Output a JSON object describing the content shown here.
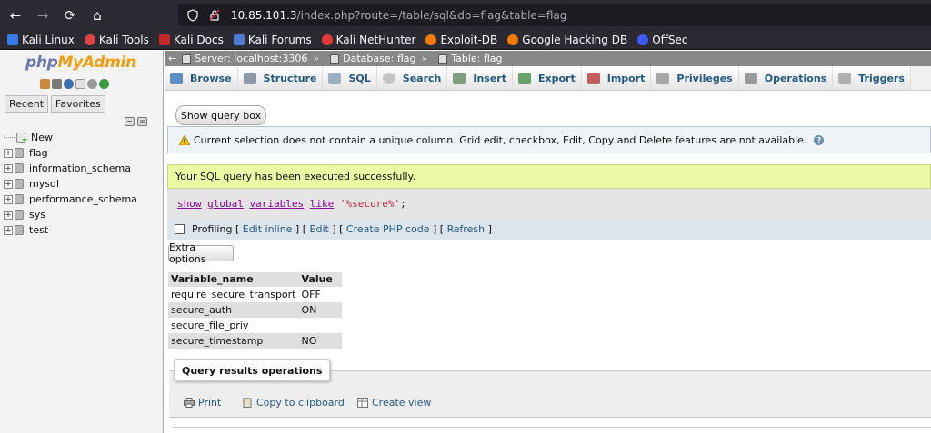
{
  "browser": {
    "url_host": "10.85.101.3",
    "url_path": "/index.php?route=/table/sql&db=flag&table=flag",
    "bookmarks": [
      "Kali Linux",
      "Kali Tools",
      "Kali Docs",
      "Kali Forums",
      "Kali NetHunter",
      "Exploit-DB",
      "Google Hacking DB",
      "OffSec"
    ]
  },
  "sidebar": {
    "logo_php": "php",
    "logo_my": "MyAdmin",
    "tab_recent": "Recent",
    "tab_favorites": "Favorites",
    "databases": [
      "New",
      "flag",
      "information_schema",
      "mysql",
      "performance_schema",
      "sys",
      "test"
    ]
  },
  "breadcrumb": {
    "server": "Server: localhost:3306",
    "database": "Database: flag",
    "table": "Table: flag"
  },
  "menu": {
    "items": [
      "Browse",
      "Structure",
      "SQL",
      "Search",
      "Insert",
      "Export",
      "Import",
      "Privileges",
      "Operations",
      "Triggers"
    ]
  },
  "main": {
    "show_query_box": "Show query box",
    "warning": "Current selection does not contain a unique column. Grid edit, checkbox, Edit, Copy and Delete features are not available.",
    "success": "Your SQL query has been executed successfully.",
    "sql": {
      "kw1": "show",
      "kw2": "global",
      "kw3": "variables",
      "kw4": "like",
      "str": "'%secure%'",
      "end": ";"
    },
    "profiling": {
      "label": "Profiling",
      "edit_inline": "Edit inline",
      "edit": "Edit",
      "create_php": "Create PHP code",
      "refresh": "Refresh"
    },
    "extra_options": "Extra options",
    "table": {
      "headers": [
        "Variable_name",
        "Value"
      ],
      "rows": [
        [
          "require_secure_transport",
          "OFF"
        ],
        [
          "secure_auth",
          "ON"
        ],
        [
          "secure_file_priv",
          ""
        ],
        [
          "secure_timestamp",
          "NO"
        ]
      ]
    },
    "qro": {
      "legend": "Query results operations",
      "print": "Print",
      "copy": "Copy to clipboard",
      "create_view": "Create view"
    }
  }
}
